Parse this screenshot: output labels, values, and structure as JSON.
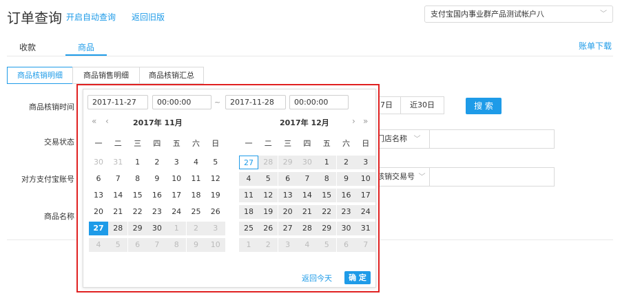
{
  "header": {
    "title": "订单查询",
    "auto_query": "开启自动查询",
    "back_old": "返回旧版",
    "account": "支付宝国内事业群产品测试帐户八",
    "chevron": "﹀"
  },
  "tabs": [
    "收款",
    "商品"
  ],
  "download": "账单下载",
  "subtabs": [
    "商品核销明细",
    "商品销售明细",
    "商品核销汇总"
  ],
  "form": {
    "verify_time_label": "商品核销时间",
    "trade_status_label": "交易状态",
    "buyer_account_label": "对方支付宝账号",
    "goods_name_label": "商品名称",
    "quick_7": "7日",
    "quick_30": "近30日",
    "search": "搜 索",
    "store_select": "门店名称",
    "verify_no_select": "核销交易号"
  },
  "picker": {
    "start_date": "2017-11-27",
    "start_time": "00:00:00",
    "tilde": "~",
    "end_date": "2017-11-28",
    "end_time": "00:00:00",
    "left_month": "2017年 11月",
    "right_month": "2017年 12月",
    "nav_prev_year": "«",
    "nav_prev_month": "‹",
    "nav_next_month": "›",
    "nav_next_year": "»",
    "weekdays": [
      "一",
      "二",
      "三",
      "四",
      "五",
      "六",
      "日"
    ],
    "left_days": [
      [
        "30",
        "31",
        "1",
        "2",
        "3",
        "4",
        "5"
      ],
      [
        "6",
        "7",
        "8",
        "9",
        "10",
        "11",
        "12"
      ],
      [
        "13",
        "14",
        "15",
        "16",
        "17",
        "18",
        "19"
      ],
      [
        "20",
        "21",
        "22",
        "23",
        "24",
        "25",
        "26"
      ],
      [
        "27",
        "28",
        "29",
        "30",
        "1",
        "2",
        "3"
      ],
      [
        "4",
        "5",
        "6",
        "7",
        "8",
        "9",
        "10"
      ]
    ],
    "right_days": [
      [
        "27",
        "28",
        "29",
        "30",
        "1",
        "2",
        "3"
      ],
      [
        "4",
        "5",
        "6",
        "7",
        "8",
        "9",
        "10"
      ],
      [
        "11",
        "12",
        "13",
        "14",
        "15",
        "16",
        "17"
      ],
      [
        "18",
        "19",
        "20",
        "21",
        "22",
        "23",
        "24"
      ],
      [
        "25",
        "26",
        "27",
        "28",
        "29",
        "30",
        "31"
      ],
      [
        "1",
        "2",
        "3",
        "4",
        "5",
        "6",
        "7"
      ]
    ],
    "back_today": "返回今天",
    "confirm": "确 定"
  },
  "colors": {
    "accent": "#1e9be8",
    "highlight_border": "#e02020"
  }
}
